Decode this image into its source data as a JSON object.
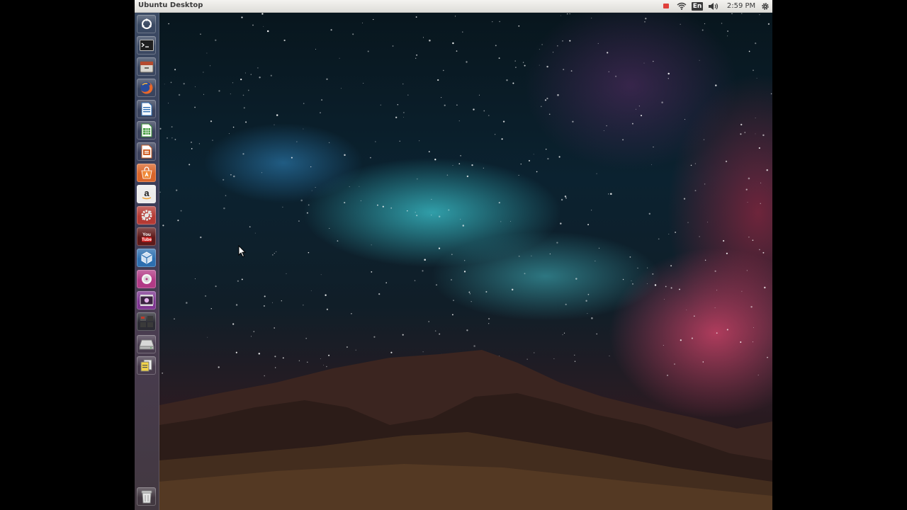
{
  "top_panel": {
    "window_title": "Ubuntu Desktop",
    "keyboard_layout": "En",
    "clock": "2:59 PM",
    "indicators": [
      "recording-icon",
      "network-wifi-icon",
      "keyboard-layout-icon",
      "volume-icon",
      "session-gear-icon"
    ]
  },
  "launcher": {
    "items": [
      {
        "name": "dash-home",
        "icon": "ubuntu-logo-icon",
        "color": "#5a6275"
      },
      {
        "name": "terminal",
        "icon": "terminal-icon",
        "color": "#2f2f2f"
      },
      {
        "name": "files",
        "icon": "file-cabinet-icon",
        "color": "#8c8880"
      },
      {
        "name": "firefox",
        "icon": "firefox-icon",
        "color": "#e0662a"
      },
      {
        "name": "libreoffice-writer",
        "icon": "writer-icon",
        "color": "#2e6fb5"
      },
      {
        "name": "libreoffice-calc",
        "icon": "calc-icon",
        "color": "#3f9a3a"
      },
      {
        "name": "libreoffice-impress",
        "icon": "impress-icon",
        "color": "#d1622a"
      },
      {
        "name": "ubuntu-software-center",
        "icon": "software-center-icon",
        "color": "#e0742c"
      },
      {
        "name": "amazon",
        "icon": "amazon-icon",
        "color": "#e8e8e8"
      },
      {
        "name": "system-settings",
        "icon": "settings-tools-icon",
        "color": "#c9413a"
      },
      {
        "name": "youtube",
        "icon": "youtube-icon",
        "color": "#8a1d1d"
      },
      {
        "name": "virtualbox",
        "icon": "virtualbox-icon",
        "color": "#2d6fb0"
      },
      {
        "name": "media-app",
        "icon": "media-app-icon",
        "color": "#b93c8c"
      },
      {
        "name": "video-app",
        "icon": "video-app-icon",
        "color": "#8b3b9b"
      },
      {
        "name": "workspace-switcher",
        "icon": "workspace-switcher-icon",
        "color": "#3b3b44"
      },
      {
        "name": "drive",
        "icon": "drive-icon",
        "color": "#9a9a9a"
      },
      {
        "name": "document-viewer",
        "icon": "document-viewer-icon",
        "color": "#7a7040"
      },
      {
        "name": "trash",
        "icon": "trash-icon",
        "color": "#8c8c8c"
      }
    ]
  },
  "colors": {
    "panel_bg": "#e6e5e1",
    "launcher_bg": "#3b3e59",
    "recording_red": "#e0403b"
  }
}
